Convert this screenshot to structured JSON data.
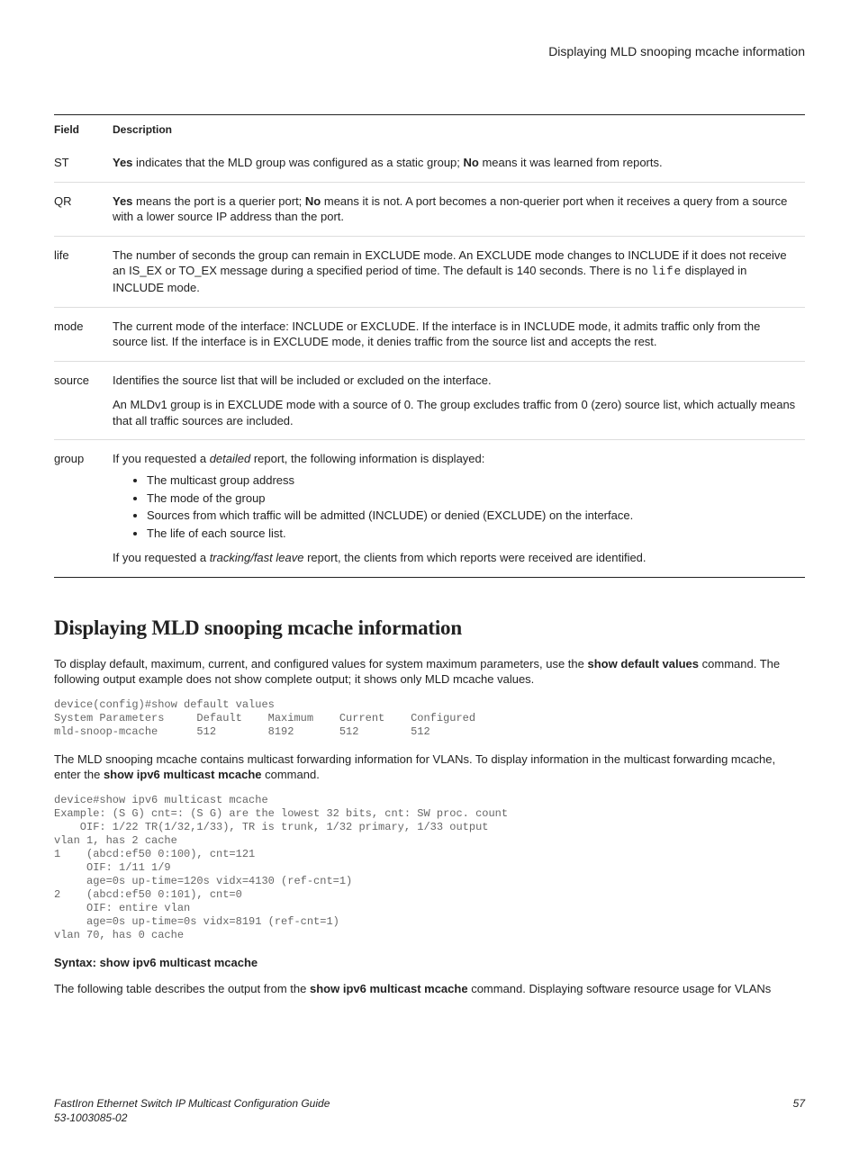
{
  "header": {
    "title": "Displaying MLD snooping mcache information"
  },
  "table": {
    "head": {
      "field": "Field",
      "desc": "Description"
    },
    "rows": {
      "st": {
        "field": "ST",
        "pre": "",
        "b1": "Yes",
        "mid1": " indicates that the MLD group was configured as a static group; ",
        "b2": "No",
        "post": " means it was learned from reports."
      },
      "qr": {
        "field": "QR",
        "pre": "",
        "b1": "Yes",
        "mid1": " means the port is a querier port; ",
        "b2": "No",
        "post": " means it is not. A port becomes a non-querier port when it receives a query from a source with a lower source IP address than the port."
      },
      "life": {
        "field": "life",
        "pre": "The number of seconds the group can remain in EXCLUDE mode. An EXCLUDE mode changes to INCLUDE if it does not receive an IS_EX or TO_EX message during a specified period of time. The default is 140 seconds. There is no ",
        "code": "life",
        "post": " displayed in INCLUDE mode."
      },
      "mode": {
        "field": "mode",
        "text": "The current mode of the interface: INCLUDE or EXCLUDE. If the interface is in INCLUDE mode, it admits traffic only from the source list. If the interface is in EXCLUDE mode, it denies traffic from the source list and accepts the rest."
      },
      "source": {
        "field": "source",
        "p1": "Identifies the source list that will be included or excluded on the interface.",
        "p2": "An MLDv1 group is in EXCLUDE mode with a source of 0. The group excludes traffic from 0 (zero) source list, which actually means that all traffic sources are included."
      },
      "group": {
        "field": "group",
        "lead_pre": "If you requested a ",
        "lead_i": "detailed",
        "lead_post": " report, the following information is displayed:",
        "b1": "The multicast group address",
        "b2": "The mode of the group",
        "b3": "Sources from which traffic will be admitted (INCLUDE) or denied (EXCLUDE) on the interface.",
        "b4": "The life of each source list.",
        "trail_pre": "If you requested a ",
        "trail_i": "tracking/fast leave",
        "trail_post": " report, the clients from which reports were received are identified."
      }
    }
  },
  "section": {
    "heading": "Displaying MLD snooping mcache information",
    "p1_pre": "To display default, maximum, current, and configured values for system maximum parameters, use the ",
    "p1_b": "show default values",
    "p1_post": " command. The following output example does not show complete output; it shows only MLD mcache values.",
    "code1": "device(config)#show default values\nSystem Parameters     Default    Maximum    Current    Configured\nmld-snoop-mcache      512        8192       512        512",
    "p2_pre": "The MLD snooping mcache contains multicast forwarding information for VLANs. To display information in the multicast forwarding mcache, enter the ",
    "p2_b": "show ipv6 multicast mcache",
    "p2_post": " command.",
    "code2": "device#show ipv6 multicast mcache\nExample: (S G) cnt=: (S G) are the lowest 32 bits, cnt: SW proc. count\n    OIF: 1/22 TR(1/32,1/33), TR is trunk, 1/32 primary, 1/33 output\nvlan 1, has 2 cache\n1    (abcd:ef50 0:100), cnt=121\n     OIF: 1/11 1/9\n     age=0s up-time=120s vidx=4130 (ref-cnt=1)\n2    (abcd:ef50 0:101), cnt=0\n     OIF: entire vlan\n     age=0s up-time=0s vidx=8191 (ref-cnt=1)\nvlan 70, has 0 cache",
    "syntax": "Syntax: show ipv6 multicast mcache",
    "p3_pre": "The following table describes the output from the ",
    "p3_b": "show ipv6 multicast mcache",
    "p3_post": " command. Displaying software resource usage for VLANs"
  },
  "footer": {
    "left1": "FastIron Ethernet Switch IP Multicast Configuration Guide",
    "left2": "53-1003085-02",
    "right": "57"
  }
}
